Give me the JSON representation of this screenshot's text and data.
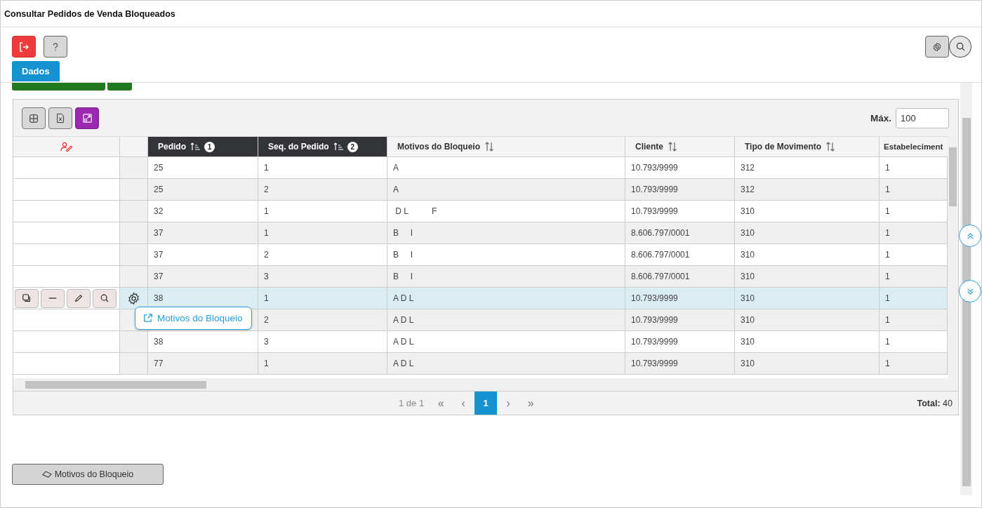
{
  "window": {
    "title": "Consultar Pedidos de Venda Bloqueados"
  },
  "tabs": [
    {
      "label": "Dados",
      "selected": true
    }
  ],
  "grid": {
    "max_label": "Máx.",
    "max_value": "100",
    "columns": [
      {
        "label": "Pedido",
        "sorted": true,
        "order": "1"
      },
      {
        "label": "Seq. do Pedido",
        "sorted": true,
        "order": "2"
      },
      {
        "label": "Motivos do Bloqueio",
        "sorted": false
      },
      {
        "label": "Cliente",
        "sorted": false
      },
      {
        "label": "Tipo de Movimento",
        "sorted": false
      },
      {
        "label": "Estabeleciment"
      }
    ],
    "rows": [
      {
        "selected": false,
        "cells": [
          "25",
          "1",
          "A",
          "10.793/9999",
          "312",
          "1"
        ]
      },
      {
        "selected": false,
        "cells": [
          "25",
          "2",
          "A",
          "10.793/9999",
          "312",
          "1"
        ]
      },
      {
        "selected": false,
        "cells": [
          "32",
          "1",
          " D L          F",
          "10.793/9999",
          "310",
          "1"
        ]
      },
      {
        "selected": false,
        "cells": [
          "37",
          "1",
          "B     I",
          "8.606.797/0001",
          "310",
          "1"
        ]
      },
      {
        "selected": false,
        "cells": [
          "37",
          "2",
          "B     I",
          "8.606.797/0001",
          "310",
          "1"
        ]
      },
      {
        "selected": false,
        "cells": [
          "37",
          "3",
          "B     I",
          "8.606.797/0001",
          "310",
          "1"
        ]
      },
      {
        "selected": true,
        "cells": [
          "38",
          "1",
          "A D L",
          "10.793/9999",
          "310",
          "1"
        ]
      },
      {
        "selected": false,
        "cells": [
          null,
          "2",
          "A D L",
          "10.793/9999",
          "310",
          "1"
        ]
      },
      {
        "selected": false,
        "cells": [
          "38",
          "3",
          "A D L",
          "10.793/9999",
          "310",
          "1"
        ]
      },
      {
        "selected": false,
        "cells": [
          "77",
          "1",
          "A D L",
          "10.793/9999",
          "310",
          "1"
        ]
      }
    ],
    "popup": {
      "label": "Motivos do Bloqueio"
    },
    "pager": {
      "info": "1 de 1",
      "first": "«",
      "prev": "‹",
      "next": "›",
      "last": "»",
      "pages": [
        {
          "label": "1",
          "selected": true
        }
      ],
      "total_label": "Total:",
      "total": "40"
    }
  },
  "footer_button": {
    "label": "Motivos do Bloqueio"
  }
}
